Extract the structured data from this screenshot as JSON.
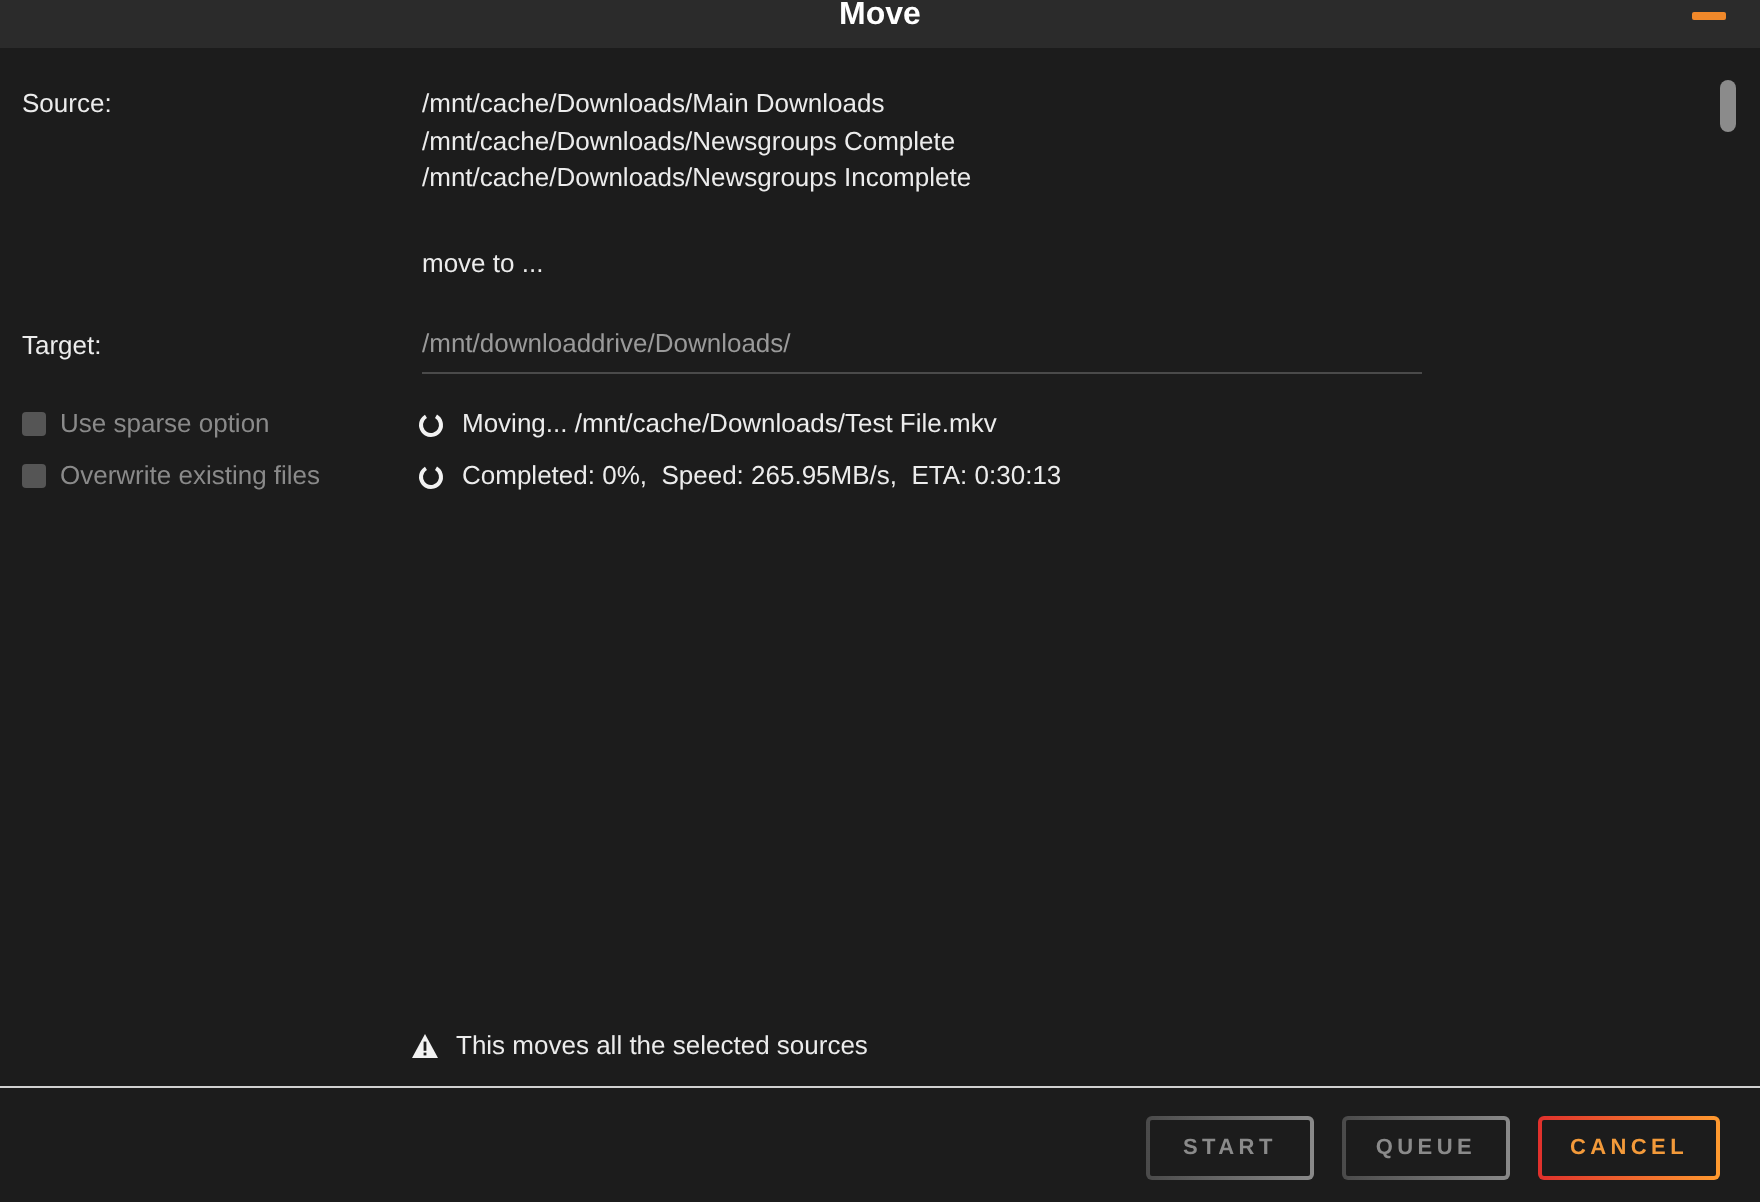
{
  "window": {
    "title": "Move"
  },
  "source": {
    "label": "Source:",
    "paths": [
      "/mnt/cache/Downloads/Main Downloads",
      "/mnt/cache/Downloads/Newsgroups Complete",
      "/mnt/cache/Downloads/Newsgroups Incomplete"
    ]
  },
  "move_to": "move to ...",
  "target": {
    "label": "Target:",
    "value": "/mnt/downloaddrive/Downloads/",
    "disabled": true
  },
  "options": [
    {
      "label": "Use sparse option",
      "checked": false,
      "disabled": true
    },
    {
      "label": "Overwrite existing files",
      "checked": false,
      "disabled": true
    }
  ],
  "progress": [
    {
      "text": "Moving... /mnt/cache/Downloads/Test File.mkv"
    },
    {
      "text": "Completed: 0%,  Speed: 265.95MB/s,  ETA: 0:30:13"
    }
  ],
  "warning": "This moves all the selected sources",
  "buttons": [
    {
      "label": "START",
      "disabled": true
    },
    {
      "label": "QUEUE",
      "disabled": true
    },
    {
      "label": "CANCEL",
      "disabled": false
    }
  ]
}
